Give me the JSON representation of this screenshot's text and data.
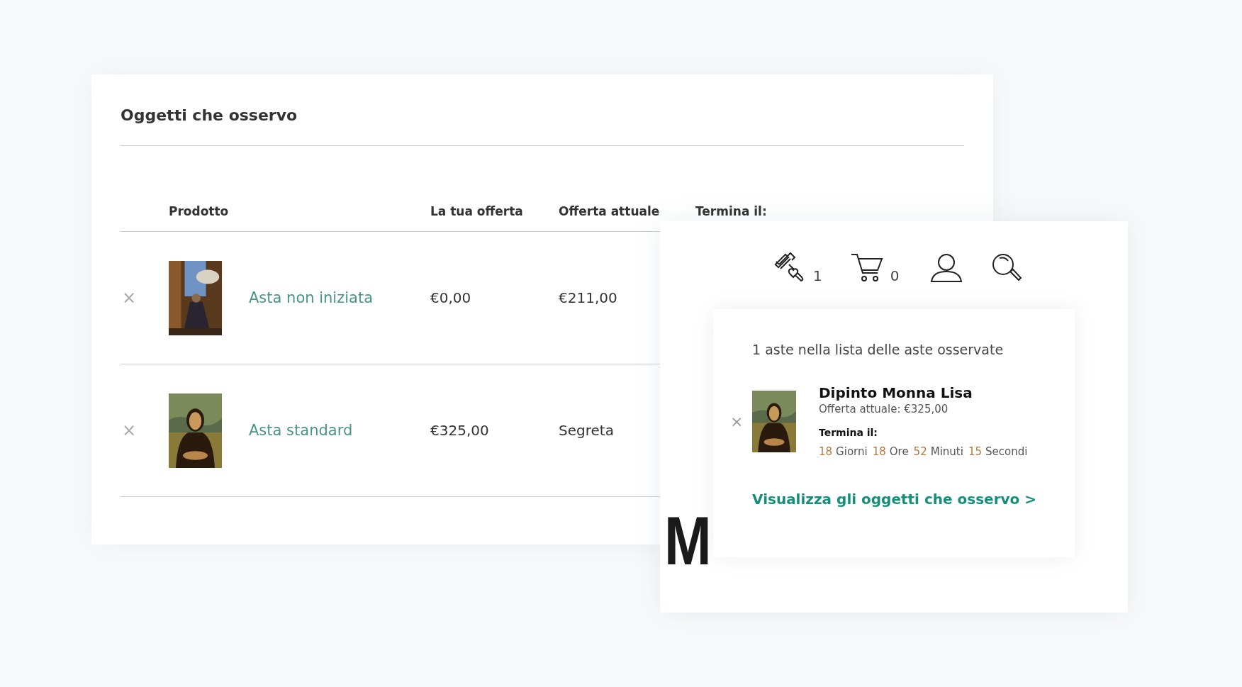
{
  "watchlist": {
    "title": "Oggetti che osservo",
    "columns": [
      "Prodotto",
      "La tua offerta",
      "Offerta attuale",
      "Termina il:"
    ],
    "rows": [
      {
        "remove": "×",
        "product": "Asta non iniziata",
        "your_bid": "€0,00",
        "current_bid": "€211,00"
      },
      {
        "remove": "×",
        "product": "Asta standard",
        "your_bid": "€325,00",
        "current_bid": "Segreta"
      }
    ]
  },
  "header": {
    "background_text": "M",
    "watch_count": "1",
    "cart_count": "0"
  },
  "popup": {
    "summary": "1 aste nella lista delle aste osservate",
    "items": [
      {
        "remove": "×",
        "name": "Dipinto Monna Lisa",
        "current_bid": "Offerta attuale: €325,00",
        "ends_label": "Termina il:",
        "countdown": [
          {
            "value": "18",
            "unit": "Giorni"
          },
          {
            "value": "18",
            "unit": "Ore"
          },
          {
            "value": "52",
            "unit": "Minuti"
          },
          {
            "value": "15",
            "unit": "Secondi"
          }
        ]
      }
    ],
    "link": "Visualizza gli oggetti che osservo >"
  }
}
